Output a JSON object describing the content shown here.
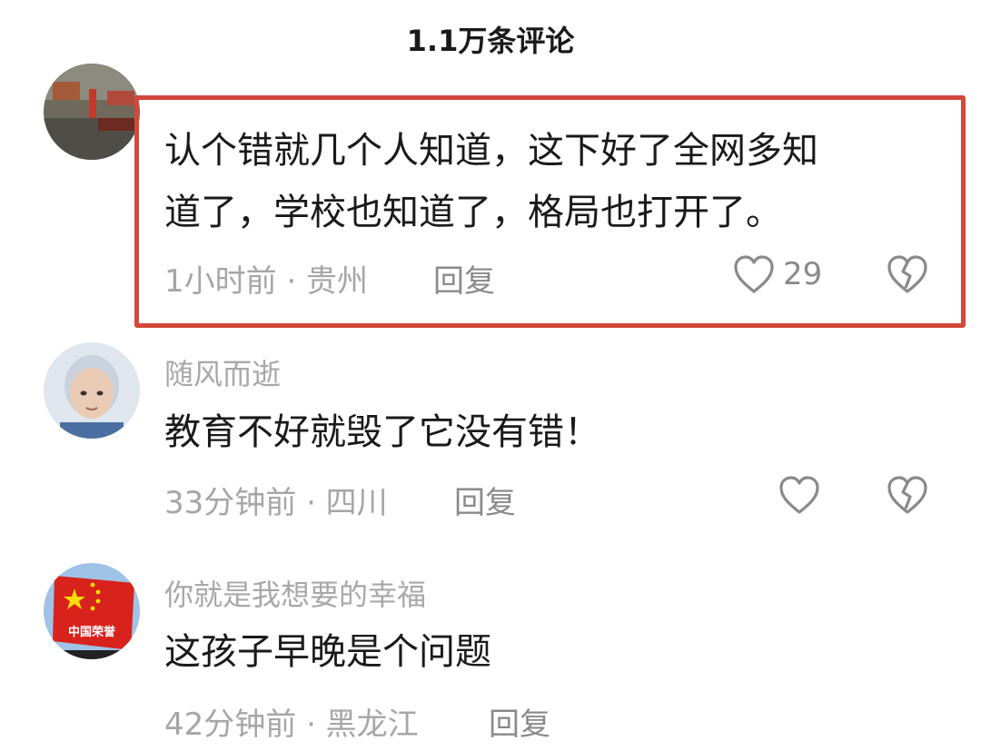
{
  "header": {
    "title": "1.1万条评论"
  },
  "comments": [
    {
      "username": "",
      "content_lines": [
        "认个错就几个人知道，这下好了全网多知",
        "道了，学校也知道了，格局也打开了。"
      ],
      "time": "1小时前",
      "location": "贵州",
      "meta": "1小时前 · 贵州",
      "reply_label": "回复",
      "likes": "29",
      "highlighted": true
    },
    {
      "username": "随风而逝",
      "content_lines": [
        "教育不好就毁了它没有错！"
      ],
      "time": "33分钟前",
      "location": "四川",
      "meta": "33分钟前 · 四川",
      "reply_label": "回复",
      "likes": "",
      "highlighted": false
    },
    {
      "username": "你就是我想要的幸福",
      "content_lines": [
        "这孩子早晚是个问题"
      ],
      "time": "42分钟前",
      "location": "黑龙江",
      "meta": "42分钟前 · 黑龙江",
      "reply_label": "回复",
      "likes": "",
      "highlighted": false
    }
  ],
  "avatar_text": {
    "honor": "中国荣誉"
  },
  "colors": {
    "highlight": "#d2483a",
    "meta": "#a6a6a6",
    "username": "#a8a8a8",
    "text": "#1a1a1a"
  }
}
